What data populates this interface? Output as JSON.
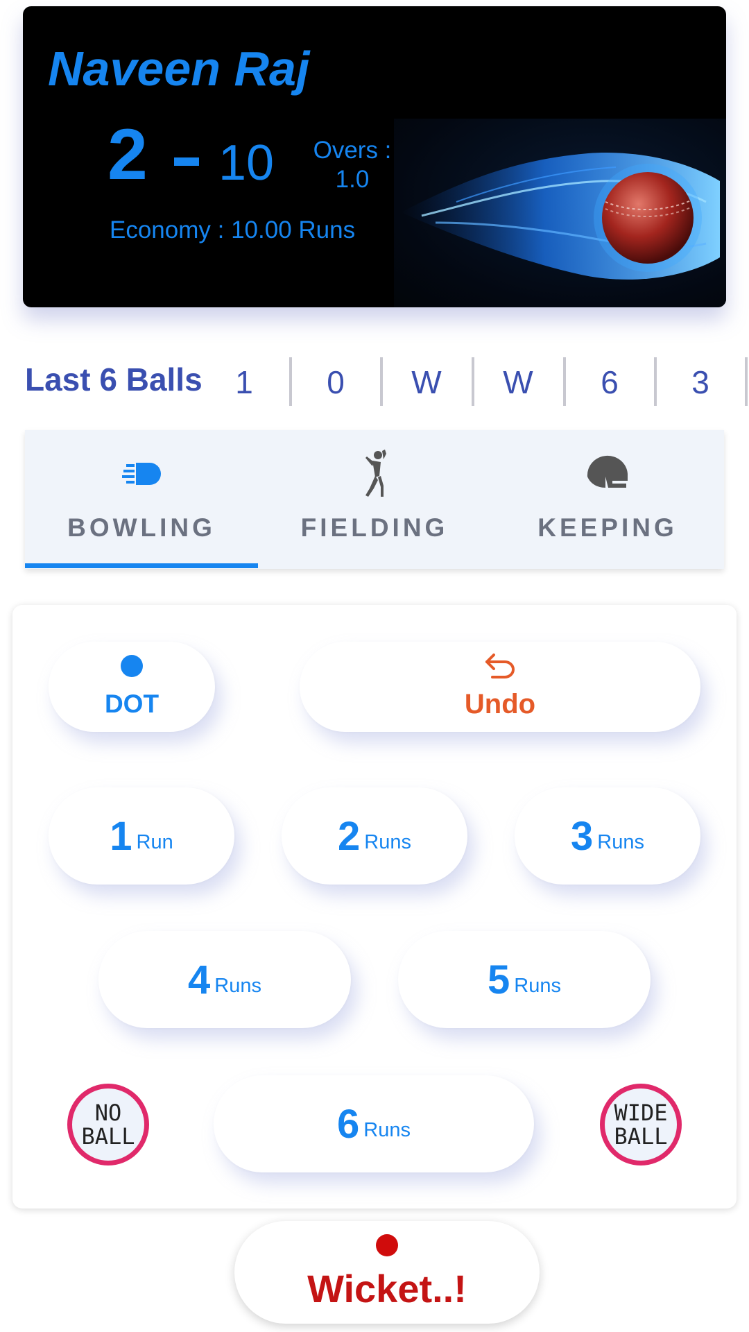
{
  "player": {
    "name": "Naveen Raj",
    "wickets": "2",
    "runs": "10",
    "overs_label": "Overs :",
    "overs_value": "1.0",
    "economy": "Economy : 10.00 Runs"
  },
  "last_balls": {
    "title": "Last 6 Balls",
    "balls": [
      "1",
      "0",
      "W",
      "W",
      "6",
      "3"
    ]
  },
  "tabs": [
    {
      "label": "BOWLING",
      "icon": "bowling-ball-icon",
      "active": true
    },
    {
      "label": "FIELDING",
      "icon": "fielder-icon",
      "active": false
    },
    {
      "label": "KEEPING",
      "icon": "helmet-icon",
      "active": false
    }
  ],
  "keypad": {
    "dot_label": "DOT",
    "undo_label": "Undo",
    "runs": [
      {
        "num": "1",
        "word": "Run"
      },
      {
        "num": "2",
        "word": "Runs"
      },
      {
        "num": "3",
        "word": "Runs"
      },
      {
        "num": "4",
        "word": "Runs"
      },
      {
        "num": "5",
        "word": "Runs"
      },
      {
        "num": "6",
        "word": "Runs"
      }
    ],
    "no_ball": {
      "line1": "NO",
      "line2": "BALL"
    },
    "wide_ball": {
      "line1": "WIDE",
      "line2": "BALL"
    }
  },
  "wicket_label": "Wicket..!",
  "colors": {
    "accent": "#1685f0",
    "undo": "#e55a28",
    "wicket": "#c41414",
    "badge_ring": "#e0296a"
  }
}
